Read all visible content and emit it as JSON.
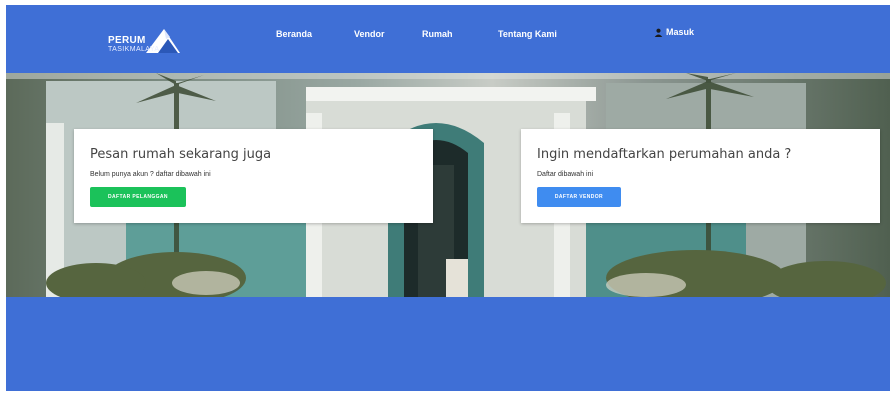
{
  "brand": {
    "line1": "PERUM",
    "line2": "TASIKMALAYA"
  },
  "nav": {
    "items": [
      {
        "label": "Beranda"
      },
      {
        "label": "Vendor"
      },
      {
        "label": "Rumah"
      },
      {
        "label": "Tentang Kami"
      }
    ],
    "login_label": "Masuk"
  },
  "hero": {
    "left_card": {
      "title": "Pesan rumah sekarang juga",
      "text": "Belum punya akun ? daftar dibawah ini",
      "button": "DAFTAR PELANGGAN"
    },
    "right_card": {
      "title": "Ingin mendaftarkan perumahan anda ?",
      "text": "Daftar dibawah ini",
      "button": "DAFTAR VENDOR"
    }
  },
  "colors": {
    "primary": "#3f6fd6",
    "green_button": "#1bc25a",
    "blue_button": "#3f8cf0"
  },
  "icons": {
    "user": "user-icon",
    "logo": "mountain-logo-icon"
  }
}
